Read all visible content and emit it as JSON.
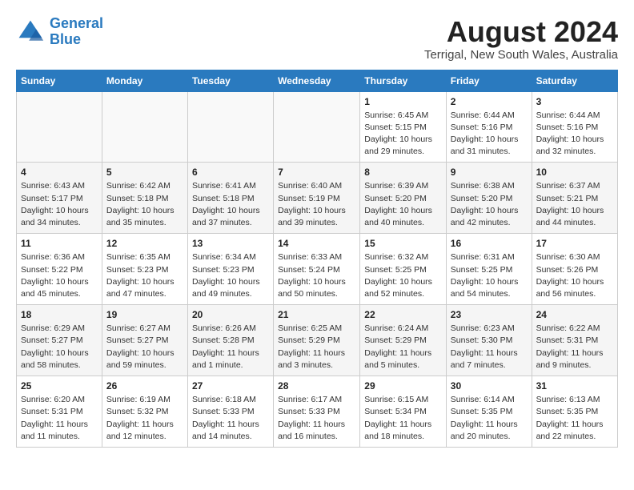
{
  "header": {
    "logo_line1": "General",
    "logo_line2": "Blue",
    "month_year": "August 2024",
    "location": "Terrigal, New South Wales, Australia"
  },
  "days_of_week": [
    "Sunday",
    "Monday",
    "Tuesday",
    "Wednesday",
    "Thursday",
    "Friday",
    "Saturday"
  ],
  "weeks": [
    [
      {
        "day": "",
        "info": ""
      },
      {
        "day": "",
        "info": ""
      },
      {
        "day": "",
        "info": ""
      },
      {
        "day": "",
        "info": ""
      },
      {
        "day": "1",
        "info": "Sunrise: 6:45 AM\nSunset: 5:15 PM\nDaylight: 10 hours\nand 29 minutes."
      },
      {
        "day": "2",
        "info": "Sunrise: 6:44 AM\nSunset: 5:16 PM\nDaylight: 10 hours\nand 31 minutes."
      },
      {
        "day": "3",
        "info": "Sunrise: 6:44 AM\nSunset: 5:16 PM\nDaylight: 10 hours\nand 32 minutes."
      }
    ],
    [
      {
        "day": "4",
        "info": "Sunrise: 6:43 AM\nSunset: 5:17 PM\nDaylight: 10 hours\nand 34 minutes."
      },
      {
        "day": "5",
        "info": "Sunrise: 6:42 AM\nSunset: 5:18 PM\nDaylight: 10 hours\nand 35 minutes."
      },
      {
        "day": "6",
        "info": "Sunrise: 6:41 AM\nSunset: 5:18 PM\nDaylight: 10 hours\nand 37 minutes."
      },
      {
        "day": "7",
        "info": "Sunrise: 6:40 AM\nSunset: 5:19 PM\nDaylight: 10 hours\nand 39 minutes."
      },
      {
        "day": "8",
        "info": "Sunrise: 6:39 AM\nSunset: 5:20 PM\nDaylight: 10 hours\nand 40 minutes."
      },
      {
        "day": "9",
        "info": "Sunrise: 6:38 AM\nSunset: 5:20 PM\nDaylight: 10 hours\nand 42 minutes."
      },
      {
        "day": "10",
        "info": "Sunrise: 6:37 AM\nSunset: 5:21 PM\nDaylight: 10 hours\nand 44 minutes."
      }
    ],
    [
      {
        "day": "11",
        "info": "Sunrise: 6:36 AM\nSunset: 5:22 PM\nDaylight: 10 hours\nand 45 minutes."
      },
      {
        "day": "12",
        "info": "Sunrise: 6:35 AM\nSunset: 5:23 PM\nDaylight: 10 hours\nand 47 minutes."
      },
      {
        "day": "13",
        "info": "Sunrise: 6:34 AM\nSunset: 5:23 PM\nDaylight: 10 hours\nand 49 minutes."
      },
      {
        "day": "14",
        "info": "Sunrise: 6:33 AM\nSunset: 5:24 PM\nDaylight: 10 hours\nand 50 minutes."
      },
      {
        "day": "15",
        "info": "Sunrise: 6:32 AM\nSunset: 5:25 PM\nDaylight: 10 hours\nand 52 minutes."
      },
      {
        "day": "16",
        "info": "Sunrise: 6:31 AM\nSunset: 5:25 PM\nDaylight: 10 hours\nand 54 minutes."
      },
      {
        "day": "17",
        "info": "Sunrise: 6:30 AM\nSunset: 5:26 PM\nDaylight: 10 hours\nand 56 minutes."
      }
    ],
    [
      {
        "day": "18",
        "info": "Sunrise: 6:29 AM\nSunset: 5:27 PM\nDaylight: 10 hours\nand 58 minutes."
      },
      {
        "day": "19",
        "info": "Sunrise: 6:27 AM\nSunset: 5:27 PM\nDaylight: 10 hours\nand 59 minutes."
      },
      {
        "day": "20",
        "info": "Sunrise: 6:26 AM\nSunset: 5:28 PM\nDaylight: 11 hours\nand 1 minute."
      },
      {
        "day": "21",
        "info": "Sunrise: 6:25 AM\nSunset: 5:29 PM\nDaylight: 11 hours\nand 3 minutes."
      },
      {
        "day": "22",
        "info": "Sunrise: 6:24 AM\nSunset: 5:29 PM\nDaylight: 11 hours\nand 5 minutes."
      },
      {
        "day": "23",
        "info": "Sunrise: 6:23 AM\nSunset: 5:30 PM\nDaylight: 11 hours\nand 7 minutes."
      },
      {
        "day": "24",
        "info": "Sunrise: 6:22 AM\nSunset: 5:31 PM\nDaylight: 11 hours\nand 9 minutes."
      }
    ],
    [
      {
        "day": "25",
        "info": "Sunrise: 6:20 AM\nSunset: 5:31 PM\nDaylight: 11 hours\nand 11 minutes."
      },
      {
        "day": "26",
        "info": "Sunrise: 6:19 AM\nSunset: 5:32 PM\nDaylight: 11 hours\nand 12 minutes."
      },
      {
        "day": "27",
        "info": "Sunrise: 6:18 AM\nSunset: 5:33 PM\nDaylight: 11 hours\nand 14 minutes."
      },
      {
        "day": "28",
        "info": "Sunrise: 6:17 AM\nSunset: 5:33 PM\nDaylight: 11 hours\nand 16 minutes."
      },
      {
        "day": "29",
        "info": "Sunrise: 6:15 AM\nSunset: 5:34 PM\nDaylight: 11 hours\nand 18 minutes."
      },
      {
        "day": "30",
        "info": "Sunrise: 6:14 AM\nSunset: 5:35 PM\nDaylight: 11 hours\nand 20 minutes."
      },
      {
        "day": "31",
        "info": "Sunrise: 6:13 AM\nSunset: 5:35 PM\nDaylight: 11 hours\nand 22 minutes."
      }
    ]
  ]
}
